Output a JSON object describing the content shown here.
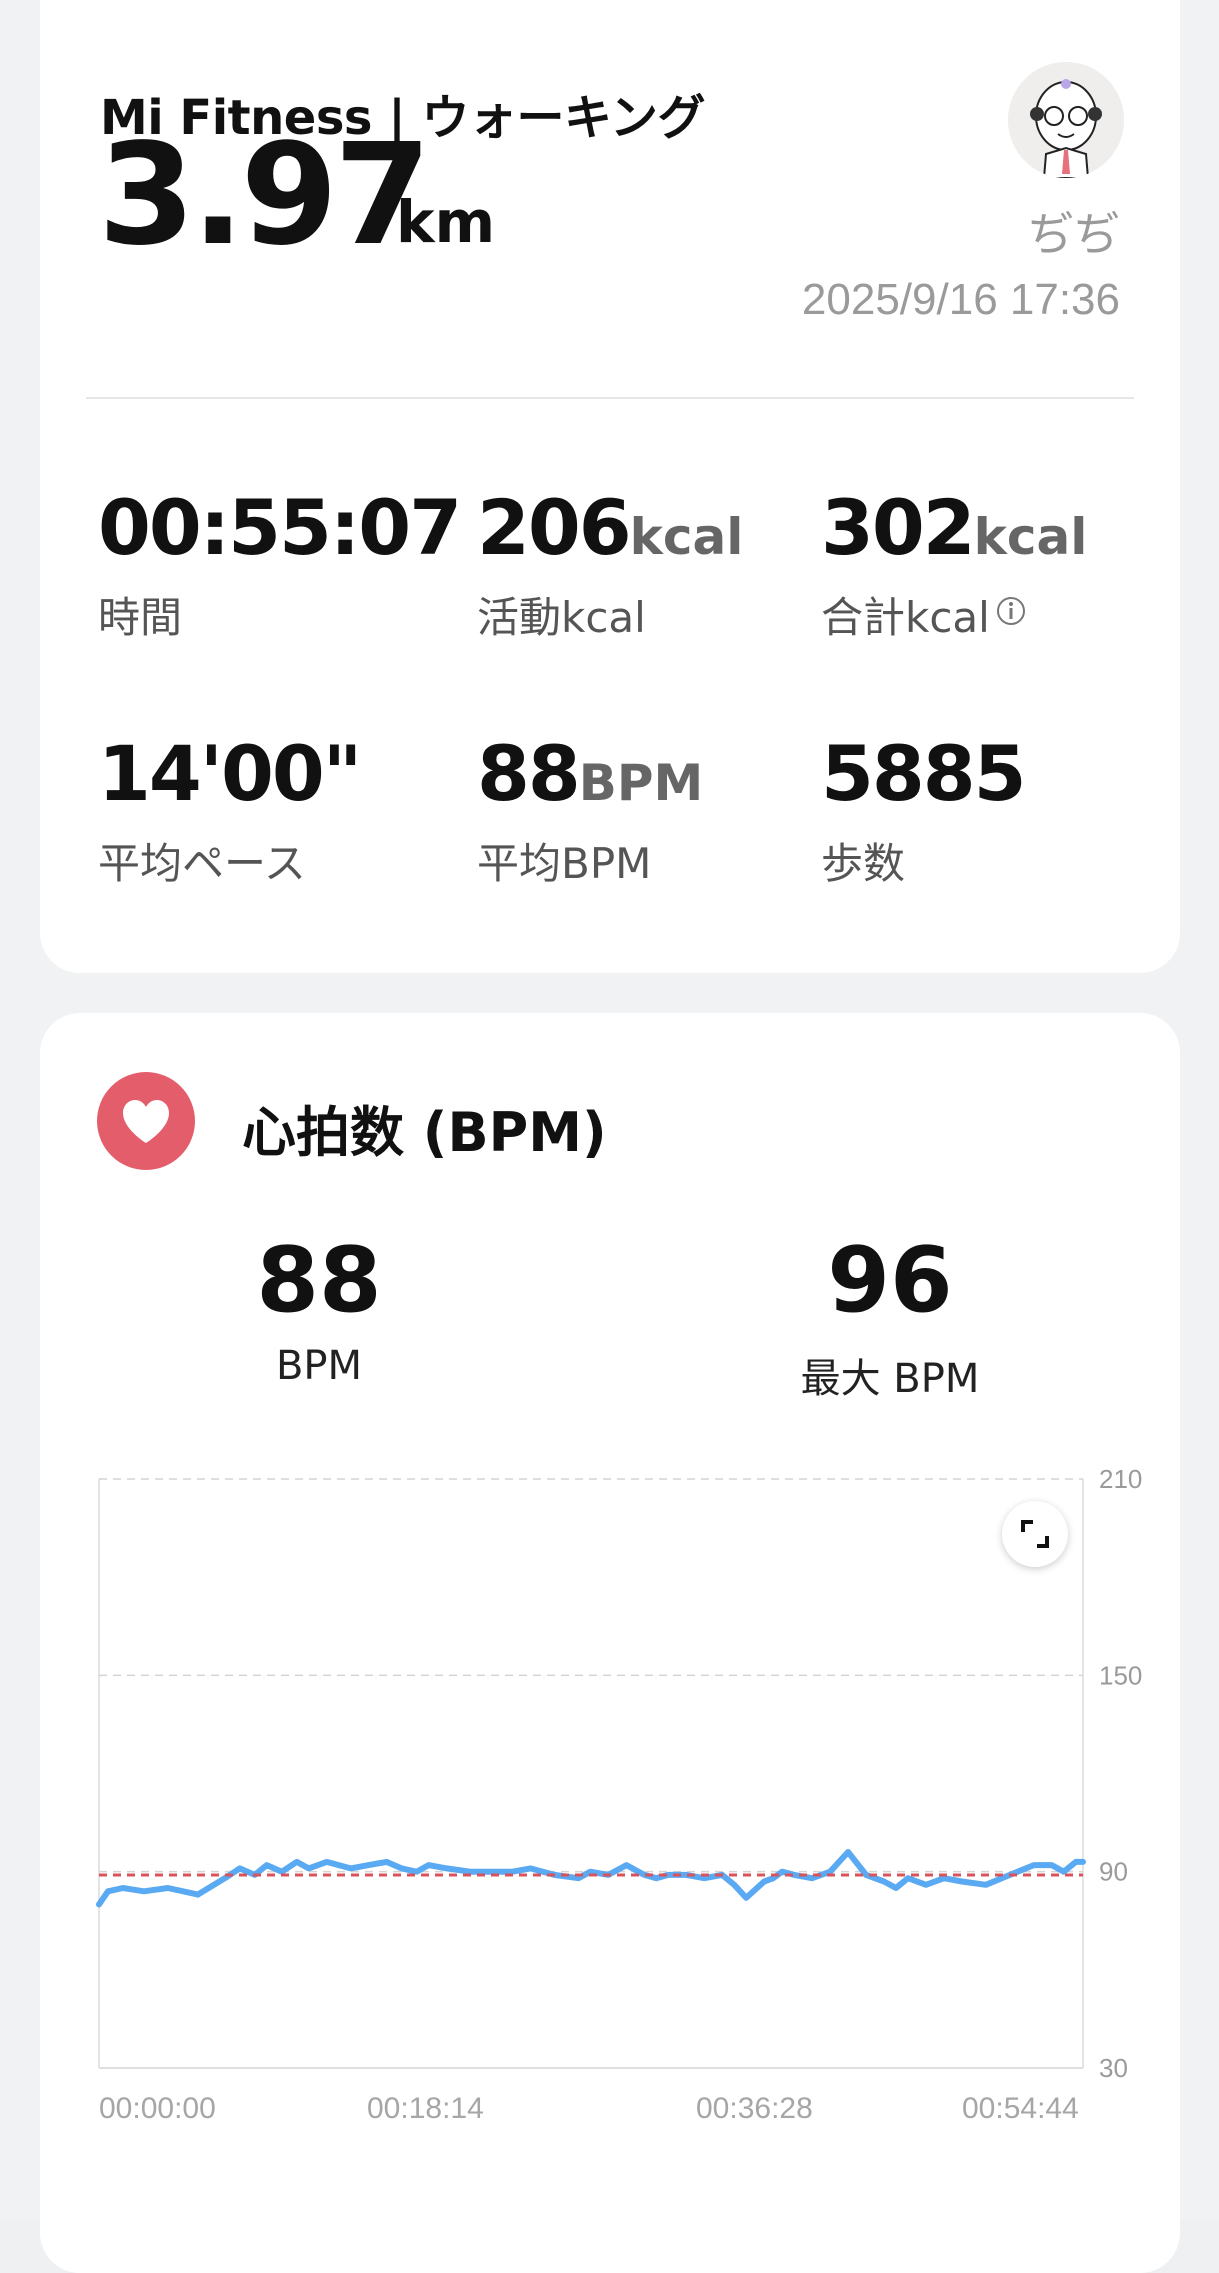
{
  "summary": {
    "app_title": "Mi Fitness | ウォーキング",
    "distance": "3.97",
    "distance_unit": "km",
    "username": "ぢぢ",
    "datetime": "2025/9/16 17:36"
  },
  "stats": [
    {
      "value": "00:55:07",
      "unit": "",
      "label": "時間"
    },
    {
      "value": "206",
      "unit": "kcal",
      "label": "活動kcal"
    },
    {
      "value": "302",
      "unit": "kcal",
      "label": "合計kcal"
    },
    {
      "value": "14'00\"",
      "unit": "",
      "label": "平均ペース"
    },
    {
      "value": "88",
      "unit": "BPM",
      "label": "平均BPM"
    },
    {
      "value": "5885",
      "unit": "",
      "label": "歩数"
    }
  ],
  "heart_rate": {
    "title": "心拍数 (BPM)",
    "avg_value": "88",
    "avg_label": "BPM",
    "max_value": "96",
    "max_label": "最大 BPM"
  },
  "colors": {
    "accent_heart": "#e45d6b",
    "line": "#5aa9f3",
    "avg_line": "#d9535c"
  },
  "icons": {
    "heart": "heart-icon",
    "expand": "expand-icon",
    "info": "info-icon"
  },
  "chart_data": {
    "type": "line",
    "title": "",
    "xlabel": "",
    "ylabel": "",
    "ylim": [
      30,
      210
    ],
    "y_ticks": [
      "210",
      "150",
      "90",
      "30"
    ],
    "x_ticks": [
      "00:00:00",
      "00:18:14",
      "00:36:28",
      "00:54:44"
    ],
    "x_range_seconds": [
      0,
      3284
    ],
    "grid": true,
    "reference_line": {
      "name": "average",
      "value": 89
    },
    "series": [
      {
        "name": "",
        "x_seconds": [
          0,
          30,
          80,
          150,
          230,
          330,
          420,
          470,
          520,
          560,
          610,
          660,
          700,
          760,
          800,
          840,
          900,
          960,
          1010,
          1060,
          1100,
          1160,
          1240,
          1300,
          1380,
          1440,
          1520,
          1600,
          1640,
          1700,
          1760,
          1820,
          1860,
          1900,
          1960,
          2020,
          2080,
          2120,
          2160,
          2220,
          2250,
          2280,
          2320,
          2380,
          2440,
          2500,
          2560,
          2620,
          2660,
          2700,
          2760,
          2820,
          2880,
          2960,
          3040,
          3120,
          3180,
          3220,
          3260,
          3284
        ],
        "values": [
          80,
          84,
          85,
          84,
          85,
          83,
          88,
          91,
          89,
          92,
          90,
          93,
          91,
          93,
          92,
          91,
          92,
          93,
          91,
          90,
          92,
          91,
          90,
          90,
          90,
          91,
          89,
          88,
          90,
          89,
          92,
          89,
          88,
          89,
          89,
          88,
          89,
          86,
          82,
          87,
          88,
          90,
          89,
          88,
          90,
          96,
          89,
          87,
          85,
          88,
          86,
          88,
          87,
          86,
          89,
          92,
          92,
          90,
          93,
          93
        ]
      }
    ]
  }
}
